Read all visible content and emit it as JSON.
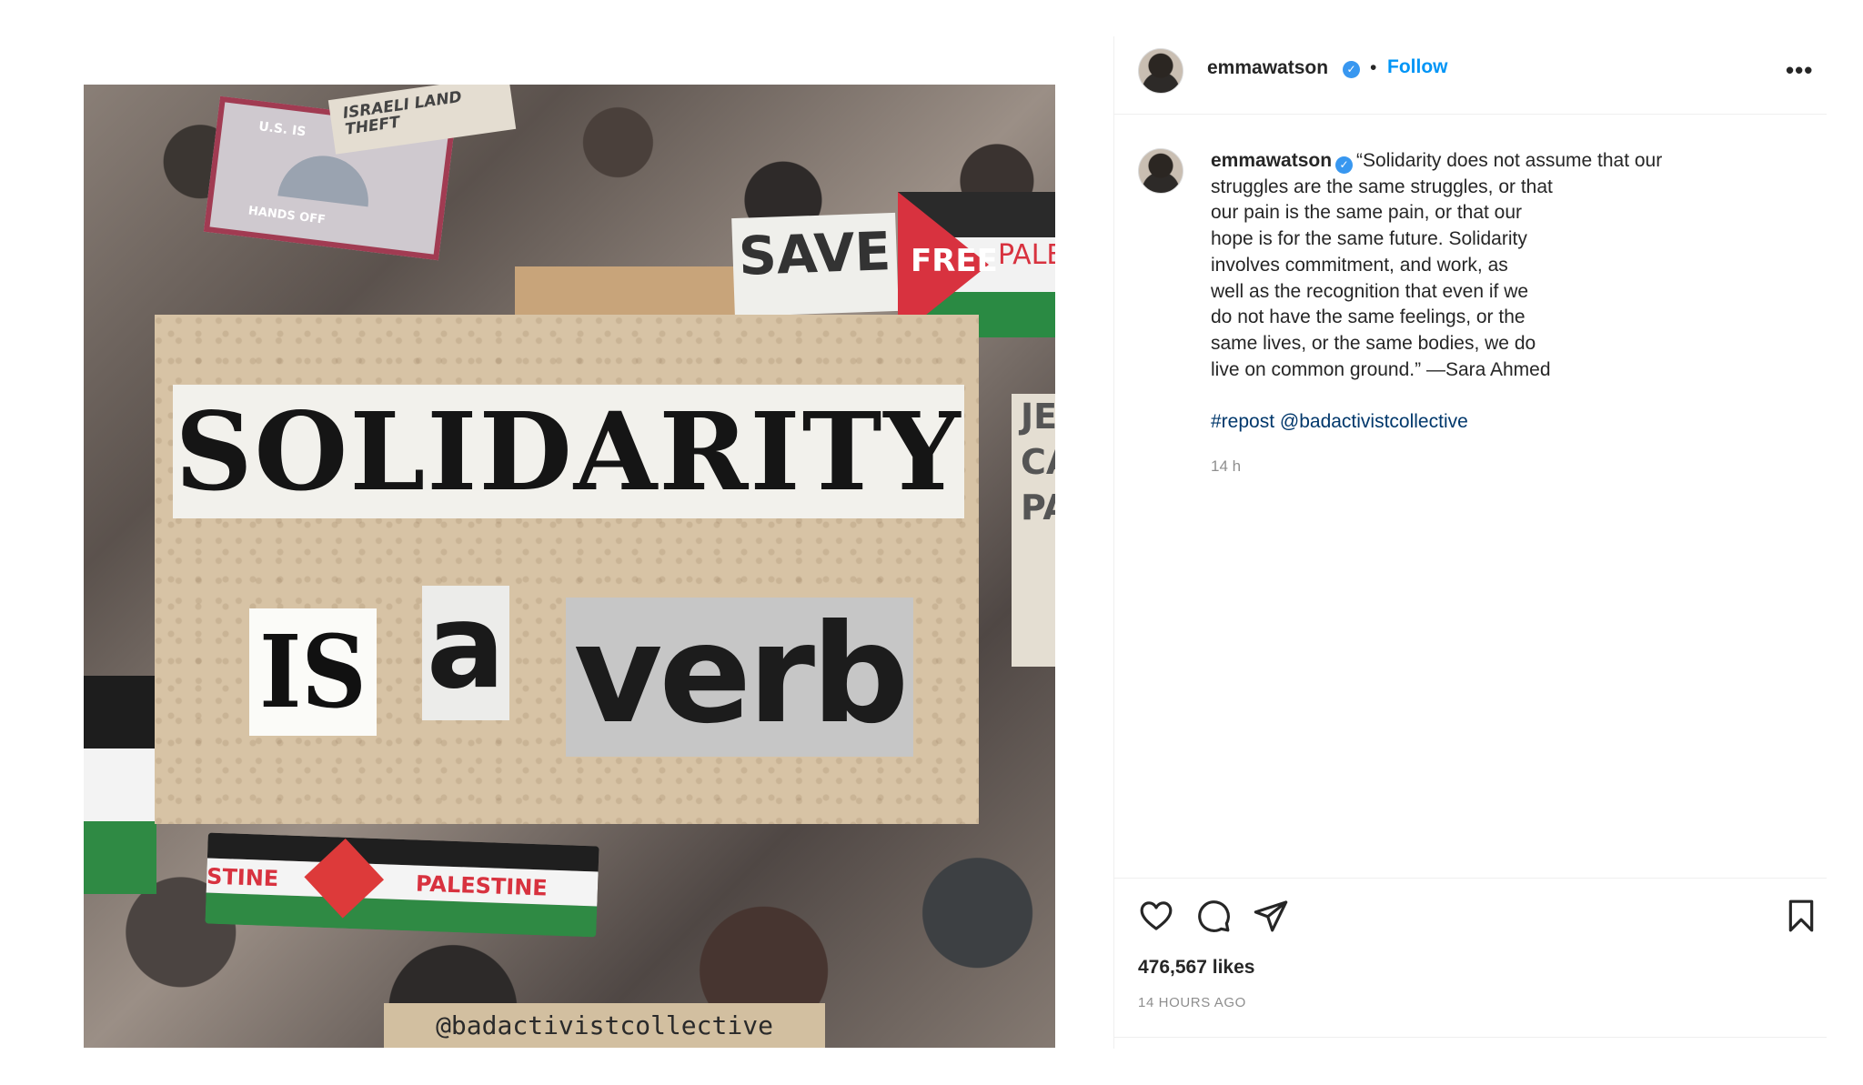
{
  "post": {
    "image": {
      "sign_israeli": "ISRAELI LAND THEFT",
      "sign_us": "U.S. IS",
      "sign_hands_off": "HANDS OFF",
      "sign_save": "SAVE",
      "sign_free": "FREE",
      "sign_pales": "PALES",
      "sign_right": "JE CA PA",
      "banner_left": "STINE",
      "banner_right": "PALESTINE",
      "headline": "SOLIDARITY",
      "word_is": "IS",
      "word_a": "a",
      "word_verb": "verb",
      "credit": "@badactivistcollective"
    }
  },
  "header": {
    "username": "emmawatson",
    "separator": "•",
    "follow_label": "Follow",
    "more_label": "•••"
  },
  "caption": {
    "username": "emmawatson",
    "lines": [
      "“Solidarity does not assume that our",
      "struggles are the same struggles, or that",
      "our pain is the same pain, or that our",
      "hope is for the same future. Solidarity",
      "involves commitment, and work, as",
      "well as the recognition that even if we",
      "do not have the same feelings, or the",
      "same lives, or the same bodies, we do",
      "live on common ground.” —Sara Ahmed"
    ],
    "hashtag": "#repost",
    "mention": "@badactivistcollective",
    "time": "14 h"
  },
  "footer": {
    "likes": "476,567 likes",
    "time_ago": "14 HOURS AGO"
  },
  "icons": {
    "like": "heart-icon",
    "comment": "comment-icon",
    "share": "send-icon",
    "save": "bookmark-icon",
    "verified": "verified-badge-icon"
  },
  "colors": {
    "link": "#0095f6",
    "verified": "#3897f0",
    "hashtag": "#00376b",
    "muted": "#8e8e8e"
  }
}
